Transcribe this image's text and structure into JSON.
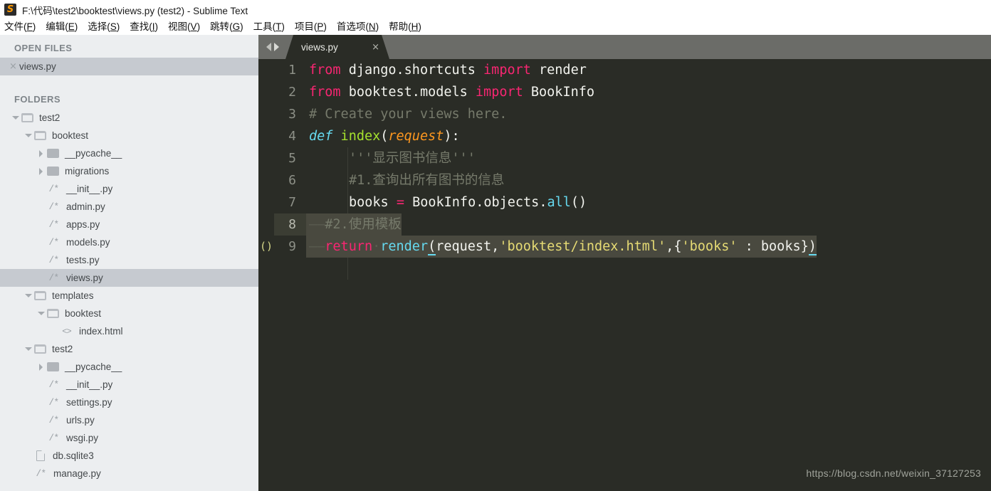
{
  "window": {
    "title": "F:\\代码\\test2\\booktest\\views.py (test2) - Sublime Text",
    "app_icon": "sublime-text-logo",
    "logo_glyph": "S"
  },
  "menubar": {
    "items": [
      {
        "label": "文件",
        "mnemonic": "F"
      },
      {
        "label": "编辑",
        "mnemonic": "E"
      },
      {
        "label": "选择",
        "mnemonic": "S"
      },
      {
        "label": "查找",
        "mnemonic": "I"
      },
      {
        "label": "视图",
        "mnemonic": "V"
      },
      {
        "label": "跳转",
        "mnemonic": "G"
      },
      {
        "label": "工具",
        "mnemonic": "T"
      },
      {
        "label": "项目",
        "mnemonic": "P"
      },
      {
        "label": "首选项",
        "mnemonic": "N"
      },
      {
        "label": "帮助",
        "mnemonic": "H"
      }
    ]
  },
  "sidebar": {
    "open_files_header": "OPEN FILES",
    "folders_header": "FOLDERS",
    "open_files": [
      {
        "label": "views.py",
        "icon": "close-icon",
        "selected": true
      }
    ],
    "tree": [
      {
        "label": "test2",
        "depth": 0,
        "icon": "folder-open",
        "arrow": "down",
        "selected": false
      },
      {
        "label": "booktest",
        "depth": 1,
        "icon": "folder-open",
        "arrow": "down",
        "selected": false
      },
      {
        "label": "__pycache__",
        "depth": 2,
        "icon": "folder-closed",
        "arrow": "right",
        "selected": false
      },
      {
        "label": "migrations",
        "depth": 2,
        "icon": "folder-closed",
        "arrow": "right",
        "selected": false
      },
      {
        "label": "__init__.py",
        "depth": 2,
        "icon": "py-icon",
        "arrow": "none",
        "selected": false
      },
      {
        "label": "admin.py",
        "depth": 2,
        "icon": "py-icon",
        "arrow": "none",
        "selected": false
      },
      {
        "label": "apps.py",
        "depth": 2,
        "icon": "py-icon",
        "arrow": "none",
        "selected": false
      },
      {
        "label": "models.py",
        "depth": 2,
        "icon": "py-icon",
        "arrow": "none",
        "selected": false
      },
      {
        "label": "tests.py",
        "depth": 2,
        "icon": "py-icon",
        "arrow": "none",
        "selected": false
      },
      {
        "label": "views.py",
        "depth": 2,
        "icon": "py-icon",
        "arrow": "none",
        "selected": true
      },
      {
        "label": "templates",
        "depth": 1,
        "icon": "folder-open",
        "arrow": "down",
        "selected": false
      },
      {
        "label": "booktest",
        "depth": 2,
        "icon": "folder-open",
        "arrow": "down",
        "selected": false
      },
      {
        "label": "index.html",
        "depth": 3,
        "icon": "html-icon",
        "arrow": "none",
        "selected": false
      },
      {
        "label": "test2",
        "depth": 1,
        "icon": "folder-open",
        "arrow": "down",
        "selected": false
      },
      {
        "label": "__pycache__",
        "depth": 2,
        "icon": "folder-closed",
        "arrow": "right",
        "selected": false
      },
      {
        "label": "__init__.py",
        "depth": 2,
        "icon": "py-icon",
        "arrow": "none",
        "selected": false
      },
      {
        "label": "settings.py",
        "depth": 2,
        "icon": "py-icon",
        "arrow": "none",
        "selected": false
      },
      {
        "label": "urls.py",
        "depth": 2,
        "icon": "py-icon",
        "arrow": "none",
        "selected": false
      },
      {
        "label": "wsgi.py",
        "depth": 2,
        "icon": "py-icon",
        "arrow": "none",
        "selected": false
      },
      {
        "label": "db.sqlite3",
        "depth": 1,
        "icon": "file-icon",
        "arrow": "none",
        "selected": false
      },
      {
        "label": "manage.py",
        "depth": 1,
        "icon": "py-icon",
        "arrow": "none",
        "selected": false
      }
    ]
  },
  "editor": {
    "nav_back": "◀",
    "nav_forward": "▶",
    "tabs": [
      {
        "label": "views.py",
        "close": "×",
        "active": true
      }
    ],
    "lines": [
      {
        "n": "1",
        "bracket": "",
        "gutter_hl": false,
        "selected": false
      },
      {
        "n": "2",
        "bracket": "",
        "gutter_hl": false,
        "selected": false
      },
      {
        "n": "3",
        "bracket": "",
        "gutter_hl": false,
        "selected": false
      },
      {
        "n": "4",
        "bracket": "",
        "gutter_hl": false,
        "selected": false
      },
      {
        "n": "5",
        "bracket": "",
        "gutter_hl": false,
        "selected": false
      },
      {
        "n": "6",
        "bracket": "",
        "gutter_hl": false,
        "selected": false
      },
      {
        "n": "7",
        "bracket": "",
        "gutter_hl": false,
        "selected": false
      },
      {
        "n": "8",
        "bracket": "",
        "gutter_hl": true,
        "selected": true
      },
      {
        "n": "9",
        "bracket": "()",
        "gutter_hl": false,
        "selected": true
      }
    ],
    "code": {
      "l1_from": "from",
      "l1_module": " django.shortcuts ",
      "l1_import": "import",
      "l1_name": " render",
      "l2_from": "from",
      "l2_module": " booktest.models ",
      "l2_import": "import",
      "l2_name": " BookInfo",
      "l3_comment": "# Create your views here.",
      "l4_def": "def",
      "l4_fn": " index",
      "l4_paren_open": "(",
      "l4_param": "request",
      "l4_tail": "):",
      "l5_docstring": "'''显示图书信息'''",
      "l6_comment": "#1.查询出所有图书的信息",
      "l7_var": "books ",
      "l7_eq": "=",
      "l7_obj": " BookInfo.objects.",
      "l7_call": "all",
      "l7_parens": "()",
      "l8_indent": "——",
      "l8_comment": "#2.使用模板",
      "l9_indent": "——",
      "l9_return": "return",
      "l9_dot": "·",
      "l9_render": "render",
      "l9_paren": "(",
      "l9_arg": "request,",
      "l9_str_path": "'booktest/index.html'",
      "l9_comma": ",{",
      "l9_str_key": "'books'",
      "l9_colon": " : ",
      "l9_books": "books",
      "l9_brace": "}",
      "l9_close": ")"
    },
    "watermark": "https://blog.csdn.net/weixin_37127253"
  },
  "colors": {
    "editor_bg": "#2a2c26",
    "sidebar_bg": "#eceef0",
    "tabbar_bg": "#6b6c68",
    "keyword": "#f92672",
    "string": "#e6db74",
    "comment": "#767a6b",
    "function": "#a6e22e",
    "type": "#66d9ef",
    "param": "#fd971f",
    "selection": "#49493f",
    "accent_orange": "#ff9800"
  }
}
